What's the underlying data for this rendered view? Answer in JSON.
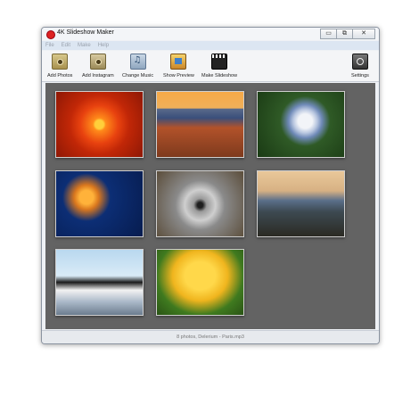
{
  "window": {
    "title": "4K Slideshow Maker",
    "controls": {
      "minimize": "▭",
      "maximize": "⧉",
      "close": "✕"
    }
  },
  "menu": [
    "File",
    "Edit",
    "Make",
    "Help"
  ],
  "toolbar": {
    "add_photos": "Add Photos",
    "add_instagram": "Add Instagram",
    "change_music": "Change Music",
    "show_preview": "Show Preview",
    "make_slideshow": "Make Slideshow",
    "settings": "Settings"
  },
  "photos": [
    "flower",
    "desert",
    "hydrangea",
    "jellyfish",
    "koala",
    "lighthouse",
    "penguins",
    "tulips"
  ],
  "status": "8 photos, Delerium - Paris.mp3"
}
